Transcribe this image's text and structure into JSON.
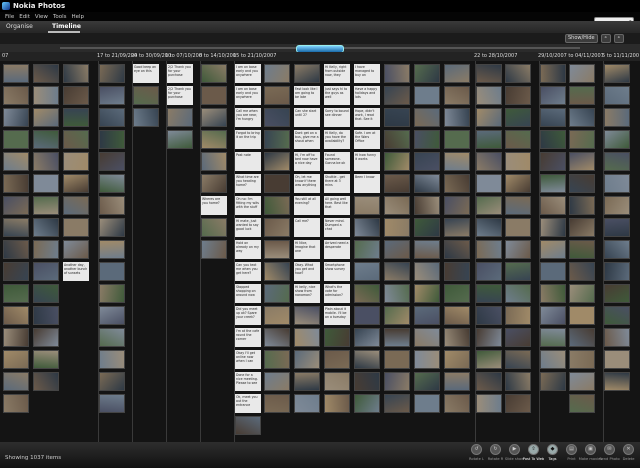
{
  "app": {
    "title": "Nokia Photos"
  },
  "menu": [
    "File",
    "Edit",
    "View",
    "Tools",
    "Help"
  ],
  "tabs": [
    {
      "label": "Organise"
    },
    {
      "label": "Timeline"
    }
  ],
  "view_controls": [
    "Show/Hide",
    "⚬",
    "⚬"
  ],
  "date_ranges": [
    {
      "label": "07"
    },
    {
      "label": "17 to 21/09/200"
    },
    {
      "label": "24 to 30/09/200"
    },
    {
      "label": "1 to 07/10/200"
    },
    {
      "label": "8 to 14/10/200"
    },
    {
      "label": "15 to 21/10/2007"
    },
    {
      "label": "22 to 28/10/2007"
    },
    {
      "label": "29/10/2007 to 04/11/2007"
    },
    {
      "label": "5 to 11/11/200"
    }
  ],
  "notes": [
    "Another day, another bunch of sunsets",
    "Good keep an eye on this",
    "2/2 Thank you for your purchase",
    "2/2 Thank you for your purchase",
    "Wheres are you home?",
    "I am on base early and you anywhere",
    "I am on base early and you anywhere",
    "Call me when you are near, I'm hungry",
    "Forgot to bring it on the trip",
    "Post note",
    "What time are you heading home?",
    "Oh no: I'm fitting my wits with the stuff",
    "Hi mate, just wanted to say good luck",
    "Hold on already on my way",
    "Can you text me when you get here?",
    "Stopped shopping on around now",
    "Did you meet up ok? Spare your creek?",
    "I'm at the cafe round the corner",
    "Okay I'll get online now when I can",
    "Done for a nice meeting. Please to see",
    "Ok, meet you out the entrance",
    "Fast look like I am going to be late",
    "Can she start until 2?",
    "Dont get on a bus, give me a shout when",
    "Hi, I'm off to bed now have a nice day",
    "Oh, let me know if there was anything",
    "You still at all evening?",
    "Call me?",
    "Hi Nice, Imagine that one",
    "Okay. What you get and how?",
    "Hi kelly, nice show from nanoman?",
    "Hi Kelly, right from outside now, they",
    "Just says hi to the guys as well",
    "Sorry to bound see dinner",
    "Hi Kelly, do you have the availability?",
    "Found someone. Gonna be ok",
    "Shuttle - get there at 3 mins",
    "All going well here. Best like that",
    "Never mind. Dumped a chat",
    "Arrived need a desperate",
    "Smartphone show survey",
    "What's the vote for admission?",
    "Plain about it mobile. I'll be on a tuesday",
    "I have managed to buy on",
    "Have a happy holidays and lots",
    "Hope, didn't work, I read that. See it",
    "Safe. I am at the Wars Office",
    "Hi how funny it works",
    "Been I know"
  ],
  "status": {
    "text": "Showing 1037 items"
  },
  "bottom_actions": [
    {
      "label": "Rotate L",
      "icon": "rotate-left-icon"
    },
    {
      "label": "Rotate R",
      "icon": "rotate-right-icon"
    },
    {
      "label": "Slide show",
      "icon": "slideshow-icon"
    },
    {
      "label": "Post To Web",
      "icon": "post-web-icon",
      "active": true
    },
    {
      "label": "Tags",
      "icon": "tag-icon",
      "active": true
    },
    {
      "label": "Print",
      "icon": "print-icon"
    },
    {
      "label": "Make movies",
      "icon": "movie-icon"
    },
    {
      "label": "Send Photo",
      "icon": "send-icon"
    },
    {
      "label": "Delete",
      "icon": "delete-icon"
    }
  ]
}
